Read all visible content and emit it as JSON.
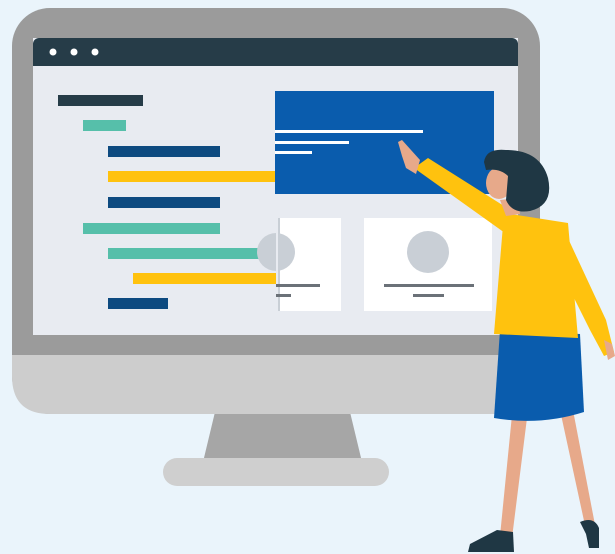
{
  "colors": {
    "background": "#eaf4fb",
    "monitor_frame": "#9b9b9b",
    "monitor_chin": "#cdcdcd",
    "stand": "#a6a6a6",
    "titlebar": "#263c48",
    "screen": "#e8ebf1",
    "navy": "#0d4a80",
    "teal": "#56bfaa",
    "yellow": "#ffc20e",
    "blue_panel": "#0a5cad",
    "card": "#ffffff",
    "avatar": "#c9cfd6",
    "card_line": "#6b7178",
    "skin": "#e7a98a",
    "hair": "#1f3744",
    "top": "#ffc20e",
    "skirt": "#0a5cad",
    "shoe": "#1f3744"
  },
  "window": {
    "dots": 3,
    "dot_icon": "window-dot-icon"
  },
  "illustration": {
    "subject": "woman-pointing-at-monitor",
    "code_lines": 9,
    "cards": 2,
    "highlight_panel_lines": 3
  }
}
